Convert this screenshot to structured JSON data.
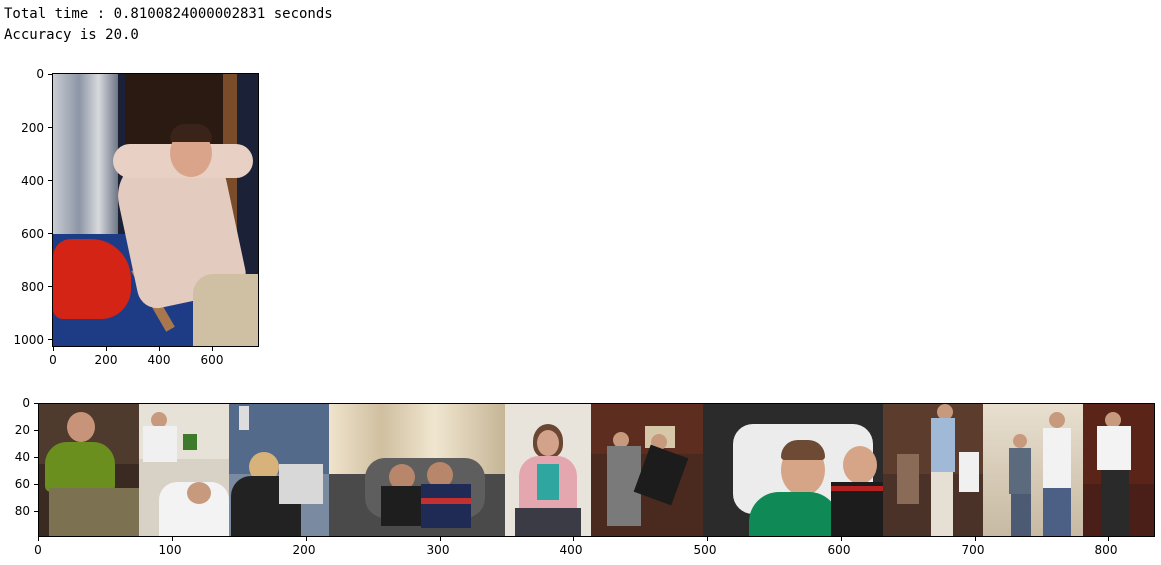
{
  "output": {
    "line1": "Total time : 0.8100824000002831 seconds",
    "line2": "Accuracy is 20.0"
  },
  "plot1": {
    "y_ticks": [
      "0",
      "200",
      "400",
      "600",
      "800",
      "1000"
    ],
    "x_ticks": [
      "0",
      "200",
      "400",
      "600"
    ]
  },
  "plot2": {
    "y_ticks": [
      "0",
      "20",
      "40",
      "60",
      "80"
    ],
    "x_ticks": [
      "0",
      "100",
      "200",
      "300",
      "400",
      "500",
      "600",
      "700",
      "800"
    ]
  }
}
